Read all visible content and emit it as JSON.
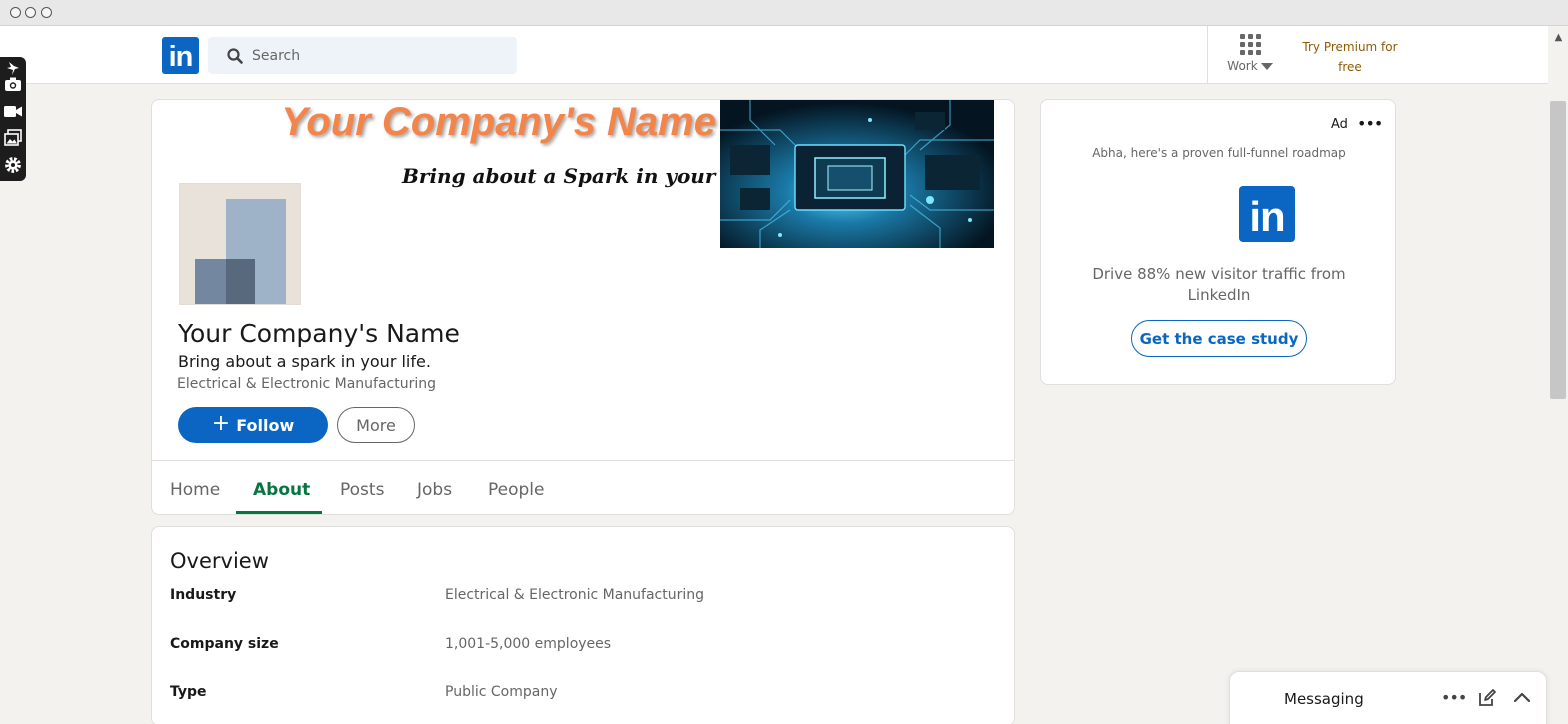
{
  "nav": {
    "logo_text": "in",
    "search_placeholder": "Search",
    "work_label": "Work",
    "premium_line1": "Try Premium for",
    "premium_line2": "free"
  },
  "company": {
    "banner_title": "Your Company's Name",
    "banner_tagline": "Bring about a Spark in your life",
    "name": "Your Company's Name",
    "tagline": "Bring about a spark in your life.",
    "industry": "Electrical & Electronic Manufacturing",
    "follow_label": "Follow",
    "more_label": "More"
  },
  "tabs": [
    {
      "label": "Home",
      "active": false
    },
    {
      "label": "About",
      "active": true
    },
    {
      "label": "Posts",
      "active": false
    },
    {
      "label": "Jobs",
      "active": false
    },
    {
      "label": "People",
      "active": false
    }
  ],
  "overview": {
    "title": "Overview",
    "rows": [
      {
        "key": "Industry",
        "value": "Electrical & Electronic Manufacturing"
      },
      {
        "key": "Company size",
        "value": "1,001-5,000 employees"
      },
      {
        "key": "Type",
        "value": "Public Company"
      }
    ]
  },
  "ad": {
    "label": "Ad",
    "subtitle": "Abha, here's a proven full-funnel roadmap",
    "logo_text": "in",
    "body": "Drive 88% new visitor traffic from LinkedIn",
    "cta": "Get the case study"
  },
  "messaging": {
    "label": "Messaging"
  },
  "colors": {
    "linkedin_blue": "#0a66c2",
    "active_tab_green": "#057642",
    "premium_gold": "#915907",
    "page_bg": "#f4f2ee"
  }
}
